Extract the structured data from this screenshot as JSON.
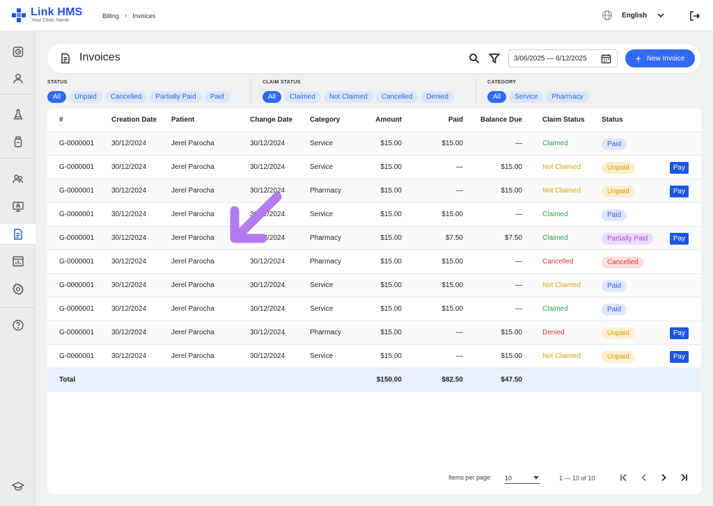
{
  "app": {
    "name": "Link HMS",
    "tagline": "Your Clinic Name"
  },
  "breadcrumb": [
    "Billing",
    "Invoices"
  ],
  "language": "English",
  "page": {
    "title": "Invoices"
  },
  "date_range": "3/06/2025 — 6/12/2025",
  "new_invoice_label": "New Invoice",
  "filters": {
    "status": {
      "label": "STATUS",
      "options": [
        "All",
        "Unpaid",
        "Cancelled",
        "Partially Paid",
        "Paid"
      ],
      "active": "All"
    },
    "claim_status": {
      "label": "CLAIM STATUS",
      "options": [
        "All",
        "Claimed",
        "Not Claimed",
        "Cancelled",
        "Denied"
      ],
      "active": "All"
    },
    "category": {
      "label": "CATEGORY",
      "options": [
        "All",
        "Service",
        "Pharmacy"
      ],
      "active": "All"
    }
  },
  "table": {
    "columns": [
      "#",
      "Creation Date",
      "Patient",
      "Change Date",
      "Category",
      "Amount",
      "Paid",
      "Balance Due",
      "Claim Status",
      "Status"
    ],
    "rows": [
      {
        "id": "G-0000001",
        "created": "30/12/2024",
        "patient": "Jerel Parocha",
        "changed": "30/12/2024",
        "category": "Service",
        "amount": "$15.00",
        "paid": "$15.00",
        "balance": "—",
        "claim": "Claimed",
        "status": "Paid",
        "pay": ""
      },
      {
        "id": "G-0000001",
        "created": "30/12/2024",
        "patient": "Jerel Parocha",
        "changed": "30/12/2024",
        "category": "Service",
        "amount": "$15.00",
        "paid": "—",
        "balance": "$15.00",
        "claim": "Not Claimed",
        "status": "Unpaid",
        "pay": "Pay"
      },
      {
        "id": "G-0000001",
        "created": "30/12/2024",
        "patient": "Jerel Parocha",
        "changed": "30/12/2024",
        "category": "Pharmacy",
        "amount": "$15.00",
        "paid": "—",
        "balance": "$15.00",
        "claim": "Not Claimed",
        "status": "Unpaid",
        "pay": "Pay"
      },
      {
        "id": "G-0000001",
        "created": "30/12/2024",
        "patient": "Jerel Parocha",
        "changed": "30/12/2024",
        "category": "Service",
        "amount": "$15.00",
        "paid": "$15.00",
        "balance": "—",
        "claim": "Claimed",
        "status": "Paid",
        "pay": ""
      },
      {
        "id": "G-0000001",
        "created": "30/12/2024",
        "patient": "Jerel Parocha",
        "changed": "30/12/2024",
        "category": "Pharmacy",
        "amount": "$15.00",
        "paid": "$7.50",
        "balance": "$7.50",
        "claim": "Claimed",
        "status": "Partially Paid",
        "pay": "Pay"
      },
      {
        "id": "G-0000001",
        "created": "30/12/2024",
        "patient": "Jerel Parocha",
        "changed": "30/12/2024",
        "category": "Pharmacy",
        "amount": "$15.00",
        "paid": "$15.00",
        "balance": "—",
        "claim": "Cancelled",
        "status": "Cancelled",
        "pay": ""
      },
      {
        "id": "G-0000001",
        "created": "30/12/2024",
        "patient": "Jerel Parocha",
        "changed": "30/12/2024",
        "category": "Service",
        "amount": "$15.00",
        "paid": "$15.00",
        "balance": "—",
        "claim": "Not Claimed",
        "status": "Paid",
        "pay": ""
      },
      {
        "id": "G-0000001",
        "created": "30/12/2024",
        "patient": "Jerel Parocha",
        "changed": "30/12/2024",
        "category": "Service",
        "amount": "$15.00",
        "paid": "$15.00",
        "balance": "—",
        "claim": "Claimed",
        "status": "Paid",
        "pay": ""
      },
      {
        "id": "G-0000001",
        "created": "30/12/2024",
        "patient": "Jerel Parocha",
        "changed": "30/12/2024",
        "category": "Pharmacy",
        "amount": "$15.00",
        "paid": "—",
        "balance": "$15.00",
        "claim": "Denied",
        "status": "Unpaid",
        "pay": "Pay"
      },
      {
        "id": "G-0000001",
        "created": "30/12/2024",
        "patient": "Jerel Parocha",
        "changed": "30/12/2024",
        "category": "Service",
        "amount": "$15.00",
        "paid": "—",
        "balance": "$15.00",
        "claim": "Not Claimed",
        "status": "Unpaid",
        "pay": "Pay"
      }
    ],
    "total": {
      "label": "Total",
      "amount": "$150.00",
      "paid": "$82.50",
      "balance": "$47.50"
    }
  },
  "pagination": {
    "items_per_page_label": "Items per page:",
    "items_per_page": "10",
    "range": "1 — 10 of 10"
  },
  "colors": {
    "accent": "#2f6af5",
    "claimed": "#2f9e44",
    "not_claimed": "#e4a10d",
    "cancelled": "#e03131",
    "annotation_arrow": "#b27cf0"
  }
}
